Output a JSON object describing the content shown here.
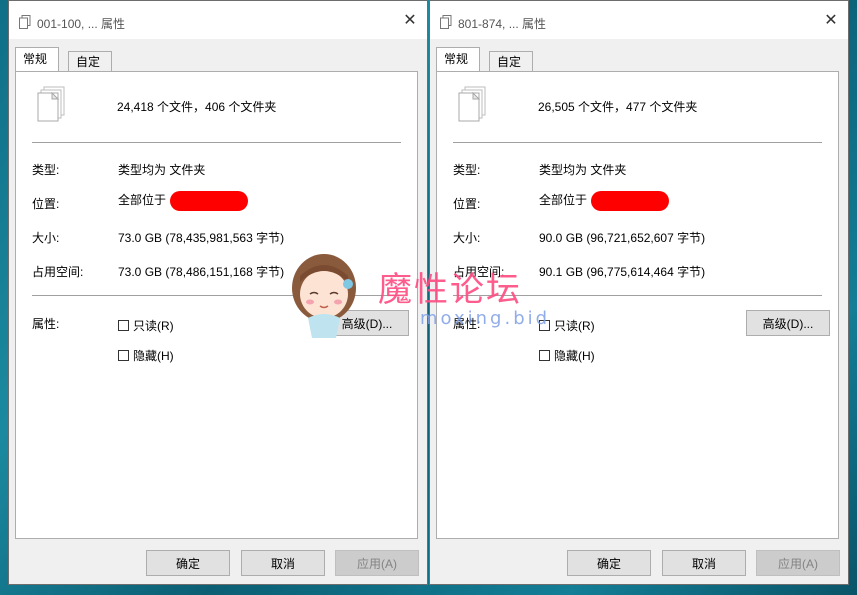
{
  "windows": [
    {
      "title": "001-100, ... 属性",
      "tabs": [
        "常规",
        "自定义"
      ],
      "summary": "24,418 个文件，406 个文件夹",
      "rows": {
        "type_label": "类型:",
        "type_value": "类型均为 文件夹",
        "location_label": "位置:",
        "location_value": "全部位于",
        "size_label": "大小:",
        "size_value": "73.0 GB (78,435,981,563 字节)",
        "disk_label": "占用空间:",
        "disk_value": "73.0 GB (78,486,151,168 字节)"
      },
      "attributes_label": "属性:",
      "readonly_label": "只读(R)",
      "hidden_label": "隐藏(H)",
      "advanced_button": "高级(D)...",
      "buttons": {
        "ok": "确定",
        "cancel": "取消",
        "apply": "应用(A)"
      }
    },
    {
      "title": "801-874, ... 属性",
      "tabs": [
        "常规",
        "自定义"
      ],
      "summary": "26,505 个文件，477 个文件夹",
      "rows": {
        "type_label": "类型:",
        "type_value": "类型均为 文件夹",
        "location_label": "位置:",
        "location_value": "全部位于",
        "size_label": "大小:",
        "size_value": "90.0 GB (96,721,652,607 字节)",
        "disk_label": "占用空间:",
        "disk_value": "90.1 GB (96,775,614,464 字节)"
      },
      "attributes_label": "属性:",
      "readonly_label": "只读(R)",
      "hidden_label": "隐藏(H)",
      "advanced_button": "高级(D)...",
      "buttons": {
        "ok": "确定",
        "cancel": "取消",
        "apply": "应用(A)"
      }
    }
  ],
  "watermark": {
    "title": "魔性论坛",
    "url": "moxing.bid"
  },
  "colors": {
    "redaction": "#ff0000",
    "watermark_pink": "#ff4b82",
    "watermark_blue": "#7e9fe6"
  }
}
